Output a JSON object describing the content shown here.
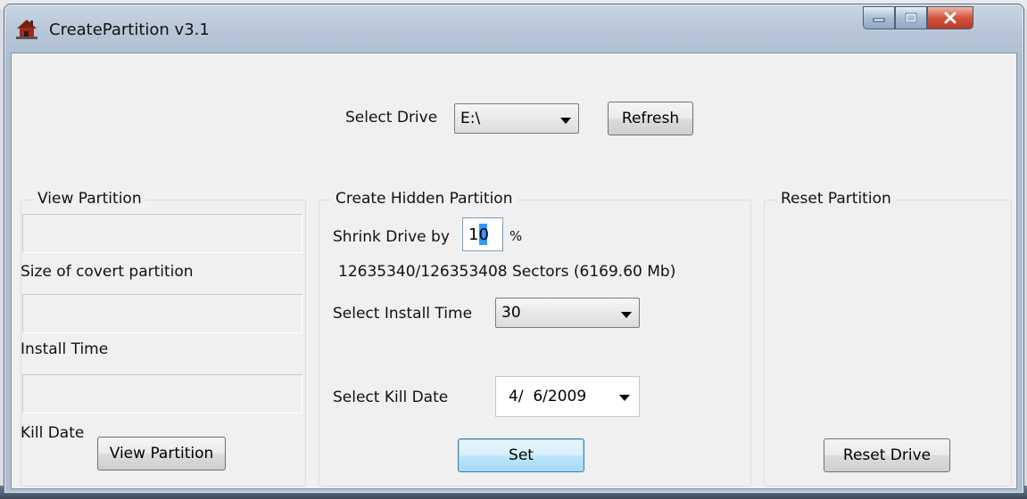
{
  "window": {
    "title": "CreatePartition v3.1",
    "app_icon": "house-icon",
    "caption_buttons": [
      "minimize-icon",
      "maximize-icon",
      "close-icon"
    ]
  },
  "drive": {
    "label": "Select Drive",
    "value": "E:\\",
    "refresh_label": "Refresh"
  },
  "view_partition": {
    "title": "View Partition",
    "size_label": "Size of covert partition",
    "install_label": "Install Time",
    "kill_label": "Kill Date",
    "button_label": "View Partition"
  },
  "create_partition": {
    "title": "Create Hidden Partition",
    "shrink_label": "Shrink Drive by",
    "shrink_value": "10",
    "percent_sign": "%",
    "sectors_text": "12635340/126353408 Sectors (6169.60 Mb)",
    "install_time_label": "Select Install Time",
    "install_time_value": "30",
    "kill_date_label": "Select Kill Date",
    "kill_date_value": "4/  6/2009",
    "set_label": "Set"
  },
  "reset_partition": {
    "title": "Reset Partition",
    "button_label": "Reset Drive"
  },
  "colors": {
    "frame": "#b8c7d8",
    "client": "#f0f0f0",
    "close_button": "#d2553c",
    "selection": "#3399ff",
    "default_button": "#a7d9f5"
  }
}
